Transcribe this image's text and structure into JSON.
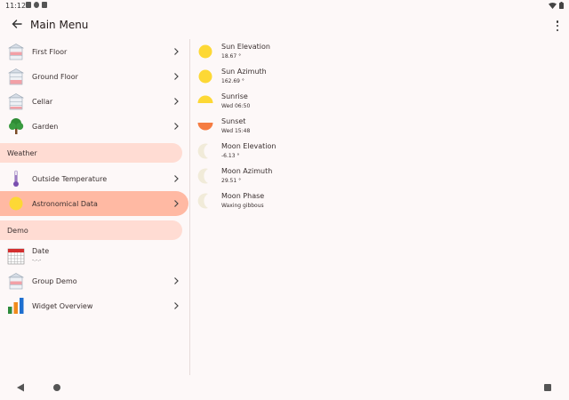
{
  "status_bar": {
    "time": "11:12"
  },
  "app_bar": {
    "title": "Main Menu"
  },
  "sidebar": {
    "items": [
      {
        "label": "First Floor"
      },
      {
        "label": "Ground Floor"
      },
      {
        "label": "Cellar"
      },
      {
        "label": "Garden"
      }
    ],
    "weather_section": {
      "label": "Weather",
      "items": [
        {
          "label": "Outside Temperature"
        },
        {
          "label": "Astronomical Data",
          "selected": true
        }
      ]
    },
    "demo_section": {
      "label": "Demo",
      "items": [
        {
          "label": "Date",
          "value": "-.-.-"
        },
        {
          "label": "Group Demo"
        },
        {
          "label": "Widget Overview"
        }
      ]
    }
  },
  "detail": {
    "items": [
      {
        "name": "Sun Elevation",
        "value": "18.67 °",
        "icon": "sun-icon"
      },
      {
        "name": "Sun Azimuth",
        "value": "162.69 °",
        "icon": "sun-icon"
      },
      {
        "name": "Sunrise",
        "value": "Wed 06:50",
        "icon": "sunrise-icon"
      },
      {
        "name": "Sunset",
        "value": "Wed 15:48",
        "icon": "sunset-icon"
      },
      {
        "name": "Moon Elevation",
        "value": "-6.13 °",
        "icon": "moon-icon"
      },
      {
        "name": "Moon Azimuth",
        "value": "29.51 °",
        "icon": "moon-icon"
      },
      {
        "name": "Moon Phase",
        "value": "Waxing gibbous",
        "icon": "moon-icon"
      }
    ]
  },
  "colors": {
    "selected": "#ffb9a3",
    "section": "#ffdcd3",
    "sun": "#fdd835",
    "sunset": "#f57c42",
    "moon": "#f1ebd9"
  }
}
